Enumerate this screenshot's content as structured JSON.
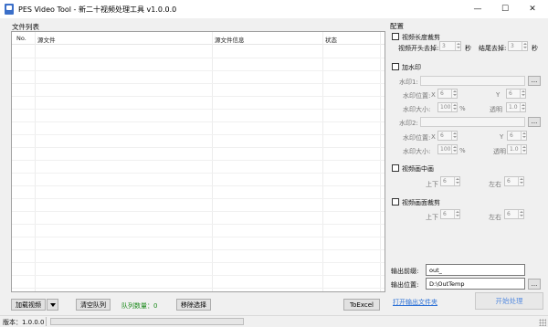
{
  "window": {
    "title": "PES Video Tool - 新二十视频处理工具 v1.0.0.0",
    "minimize": "—",
    "maximize": "☐",
    "close": "✕"
  },
  "file_list": {
    "label": "文件列表",
    "columns": [
      "No.",
      "源文件",
      "源文件信息",
      "状态"
    ],
    "rows": []
  },
  "bottom": {
    "add_video": "加载视频",
    "clear_queue": "清空队列",
    "queue_count": "队列数量：0",
    "remove_selected": "移除选择",
    "to_excel": "ToExcel"
  },
  "config": {
    "title": "配置",
    "trim": {
      "label": "视频长度裁剪",
      "start_label": "视频开头去掉:",
      "start_value": "3",
      "start_unit": "秒",
      "end_label": "结尾去掉:",
      "end_value": "3",
      "end_unit": "秒"
    },
    "watermark": {
      "label": "加水印",
      "wm1_label": "水印1:",
      "wm1_pos_label": "水印位置:",
      "wm1_x_label": "X",
      "wm1_x": "6",
      "wm1_y_label": "Y",
      "wm1_y": "6",
      "wm1_size_label": "水印大小:",
      "wm1_size": "100",
      "wm1_size_unit": "%",
      "wm1_alpha_label": "透明",
      "wm1_alpha": "1.0",
      "wm2_label": "水印2:",
      "wm2_pos_label": "水印位置:",
      "wm2_x_label": "X",
      "wm2_x": "6",
      "wm2_y_label": "Y",
      "wm2_y": "6",
      "wm2_size_label": "水印大小:",
      "wm2_size": "100",
      "wm2_size_unit": "%",
      "wm2_alpha_label": "透明",
      "wm2_alpha": "1.0",
      "browse": "..."
    },
    "scale": {
      "label": "视频画中画",
      "ud_label": "上下",
      "ud_value": "6",
      "lr_label": "左右",
      "lr_value": "6"
    },
    "crop": {
      "label": "视频画面裁剪",
      "ud_label": "上下",
      "ud_value": "6",
      "lr_label": "左右",
      "lr_value": "6"
    },
    "output_prefix_label": "输出前缀:",
    "output_prefix_value": "out_",
    "output_dir_label": "输出位置:",
    "output_dir_value": "D:\\OutTemp",
    "browse": "...",
    "open_output": "打开输出文件夹",
    "start": "开始处理"
  },
  "status": {
    "version": "版本：1.0.0.0"
  }
}
